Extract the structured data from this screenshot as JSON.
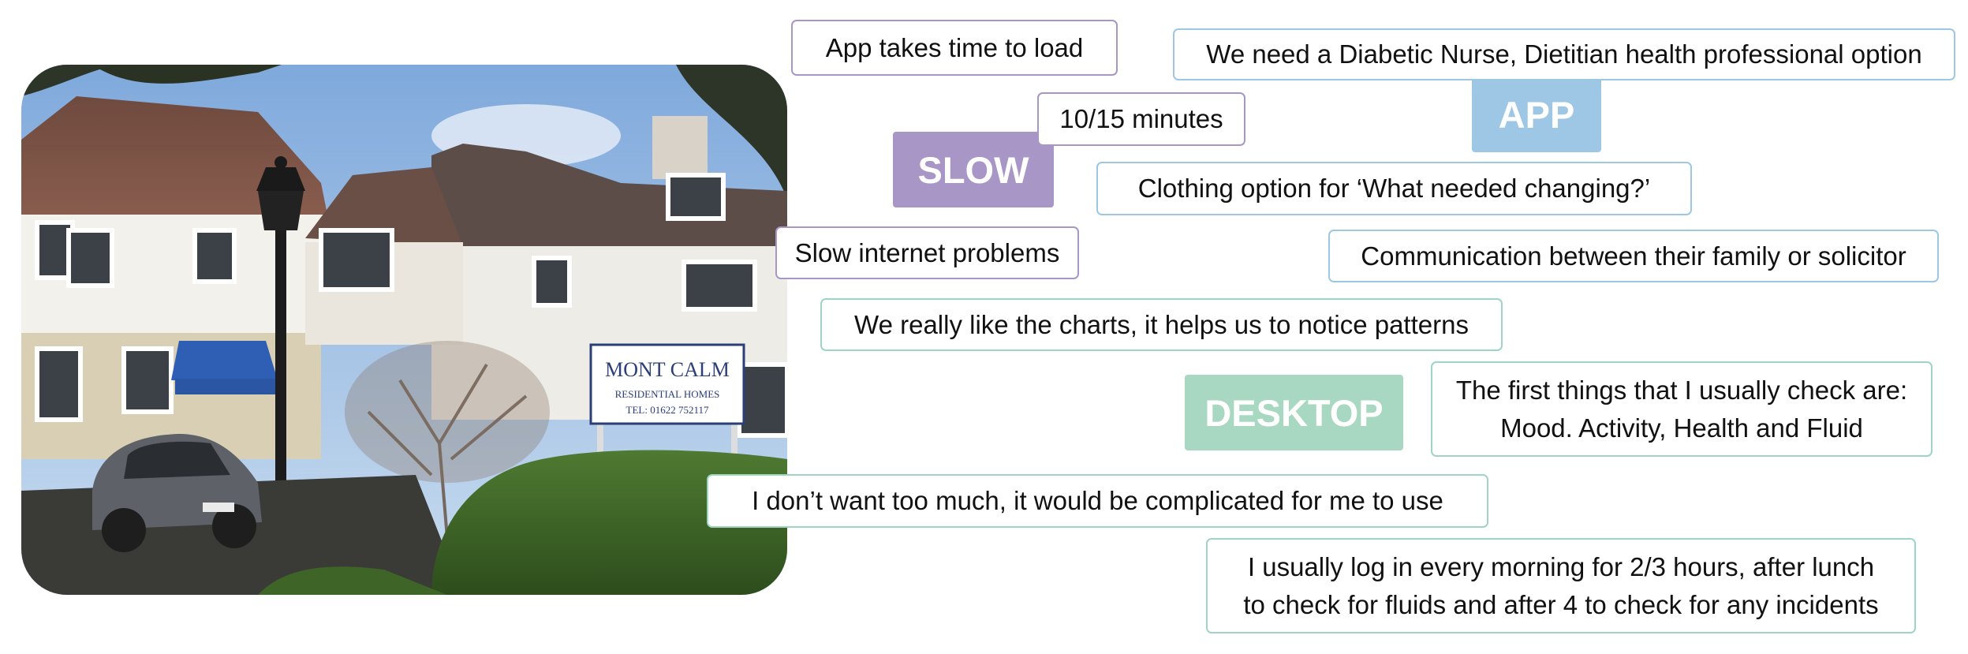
{
  "colors": {
    "slow": "#a896c7",
    "app": "#9dc7e4",
    "desktop": "#a9d8c2",
    "note_border_purple": "#a896c7",
    "note_border_blue": "#9cc8e3",
    "note_border_green": "#9fd5c0"
  },
  "photo": {
    "sign_line1": "MONT CALM",
    "sign_line2": "RESIDENTIAL HOMES",
    "sign_line3": "TEL: 01622 752117"
  },
  "tags": {
    "slow": "SLOW",
    "app": "APP",
    "desktop": "DESKTOP"
  },
  "notes": {
    "app_load": "App takes time to load",
    "minutes": "10/15 minutes",
    "slow_internet": "Slow internet problems",
    "diabetic": "We need a Diabetic Nurse, Dietitian health professional option",
    "clothing": "Clothing option for ‘What needed changing?’",
    "communication": "Communication between their family or solicitor",
    "charts": "We really like the charts, it helps us to notice patterns",
    "first_things_1": "The first things that I usually check are:",
    "first_things_2": "Mood. Activity, Health and Fluid",
    "too_much": "I don’t want too much, it would be complicated for me to use",
    "login_1": "I usually log in every morning for 2/3 hours, after lunch",
    "login_2": "to check for fluids and after 4 to check for any incidents"
  }
}
